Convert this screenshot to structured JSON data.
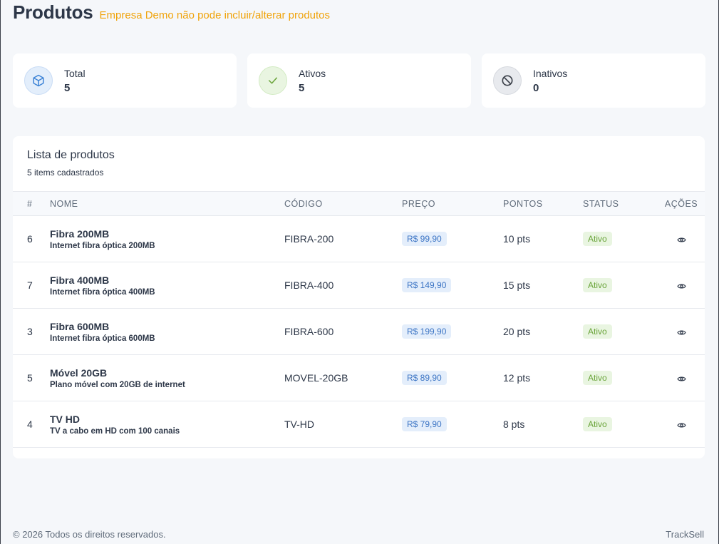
{
  "header": {
    "title": "Produtos",
    "warning": "Empresa Demo não pode incluir/alterar produtos"
  },
  "stats": [
    {
      "label": "Total",
      "value": "5",
      "icon": "box-icon"
    },
    {
      "label": "Ativos",
      "value": "5",
      "icon": "check-icon"
    },
    {
      "label": "Inativos",
      "value": "0",
      "icon": "ban-icon"
    }
  ],
  "panel": {
    "title": "Lista de produtos",
    "subtitle": "5 items cadastrados"
  },
  "table": {
    "headers": {
      "id": "#",
      "name": "NOME",
      "code": "CÓDIGO",
      "price": "PREÇO",
      "points": "PONTOS",
      "status": "STATUS",
      "actions": "AÇÕES"
    },
    "rows": [
      {
        "id": "6",
        "name": "Fibra 200MB",
        "desc": "Internet fibra óptica 200MB",
        "code": "FIBRA-200",
        "price": "R$ 99,90",
        "points": "10 pts",
        "status": "Ativo"
      },
      {
        "id": "7",
        "name": "Fibra 400MB",
        "desc": "Internet fibra óptica 400MB",
        "code": "FIBRA-400",
        "price": "R$ 149,90",
        "points": "15 pts",
        "status": "Ativo"
      },
      {
        "id": "3",
        "name": "Fibra 600MB",
        "desc": "Internet fibra óptica 600MB",
        "code": "FIBRA-600",
        "price": "R$ 199,90",
        "points": "20 pts",
        "status": "Ativo"
      },
      {
        "id": "5",
        "name": "Móvel 20GB",
        "desc": "Plano móvel com 20GB de internet",
        "code": "MOVEL-20GB",
        "price": "R$ 89,90",
        "points": "12 pts",
        "status": "Ativo"
      },
      {
        "id": "4",
        "name": "TV HD",
        "desc": "TV a cabo em HD com 100 canais",
        "code": "TV-HD",
        "price": "R$ 79,90",
        "points": "8 pts",
        "status": "Ativo"
      }
    ]
  },
  "footer": {
    "copyright": "© 2026 Todos os direitos reservados.",
    "brand": "TrackSell"
  },
  "colors": {
    "accent_warning": "#f0a30a",
    "price_badge": "#3b74c4",
    "status_active": "#6aa43a"
  }
}
